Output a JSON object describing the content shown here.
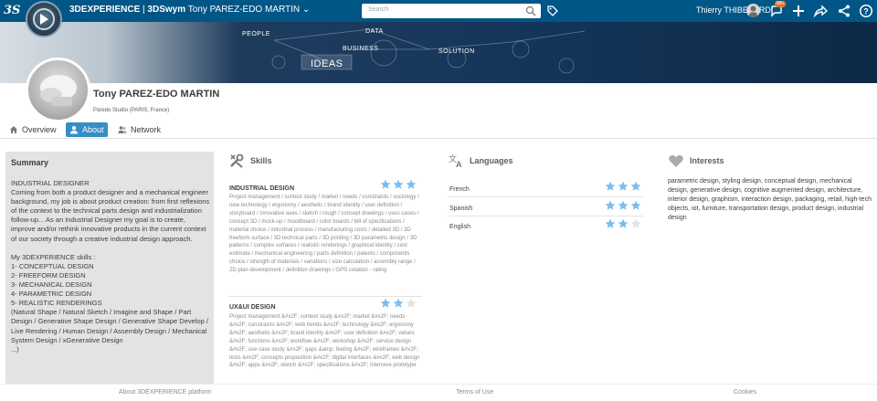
{
  "topbar": {
    "logo": "3S",
    "brand_bold": "3DEXPERIENCE",
    "brand_sep": " | ",
    "brand_app": "3DSwym",
    "brand_user": "Tony PAREZ-EDO MARTIN",
    "search_placeholder": "Search",
    "user_name": "Thierry THIBESARD",
    "notification_count": "99+",
    "bg_color": "#005686"
  },
  "banner": {
    "words": [
      "PEOPLE",
      "DATA",
      "BUSINESS",
      "IDEAS",
      "SOLUTION"
    ]
  },
  "profile": {
    "name": "Tony PAREZ-EDO MARTIN",
    "company": "Paredo Studio (PARIS, France)"
  },
  "tabs": [
    {
      "label": "Overview",
      "icon": "home-icon",
      "active": false
    },
    {
      "label": "About",
      "icon": "user-icon",
      "active": true
    },
    {
      "label": "Network",
      "icon": "people-icon",
      "active": false
    }
  ],
  "summary": {
    "title": "Summary",
    "body": "INDUSTRIAL DESIGNER\nComing from both a product designer and a mechanical engineer background, my job is about product creation: from first reflexions of the context to the technical parts design and industrialization follow-up... As an Industrial Designer my goal is to create, improve and/or rethink innovative products in the current context of our society through a creative industrial design approach.\n\nMy 3DEXPERIENCE skills :\n1- CONCEPTUAL DESIGN\n2- FREEFORM DESIGN\n3- MECHANICAL DESIGN\n4- PARAMETRIC DESIGN\n5- REALISTIC RENDERINGS\n(Natural Shape / Natural Sketch / Imagine and Shape / Part Design / Generative Shape Design / Generative Shape Develop / Live Rendering / Human Design / Assembly Design / Mechanical System Design / xGenerative Design\n...)"
  },
  "skills": {
    "title": "Skills",
    "items": [
      {
        "name": "INDUSTRIAL DESIGN",
        "rating": 3,
        "description": "Project management / contest study / market / needs / constraints / sociology / new technology / ergonomy / aesthetic / brand identity / user definition / storyboard / innovative axes / sketch / rough / concept drawings / uses cases / concept 3D / mock-up / moodboard / color boards / bill of specifications / material choice / industrial process / manufacturing costs / detailed 3D / 3D freeform surface / 3D technical parts / 3D printing / 3D parametric design / 3D patterns / complex surfaces / realistic renderings / graphical identity / cost estimate / mechanical engineering / parts definition / patents / components choice / strength of materials / variations / size calculation / assembly range / 2D plan development / definition drawings / GPS cotation - rating"
      },
      {
        "name": "UX&UI DESIGN",
        "rating": 2,
        "description": "Project management &#x2F; context study &#x2F; market &#x2F; needs &#x2F; constraints &#x2F; web trends &#x2F; technology &#x2F; ergonomy &#x2F; aesthetic &#x2F; brand identity &#x2F; user definition &#x2F; values &#x2F; functions &#x2F; workflow &#x2F; workshop &#x2F; service design &#x2F; use case study &#x2F; gaps &amp; feeling &#x2F; wireframes &#x2F; tests &#x2F; concepts proposition &#x2F; digital interfaces &#x2F; web design &#x2F; apps &#x2F; sketch &#x2F; specifications &#x2F; intensive prototype"
      }
    ]
  },
  "languages": {
    "title": "Languages",
    "items": [
      {
        "name": "French",
        "rating": 3
      },
      {
        "name": "Spanish",
        "rating": 3
      },
      {
        "name": "English",
        "rating": 2
      }
    ]
  },
  "interests": {
    "title": "Interests",
    "text": "parametric design, styling design, conceptual design, mechanical design, generative design, cognitive augmented design, architecture, interior design, graphism, interaction design, packaging, retail, high-tech objects, iot, furniture, transportation design, product design, industrial design"
  },
  "footer": {
    "about": "About 3DEXPERIENCE platform",
    "terms": "Terms of Use",
    "cookies": "Cookies"
  },
  "colors": {
    "star_on": "#78bef0",
    "star_off": "#e2e4e3",
    "tab_active": "#368ec4"
  }
}
